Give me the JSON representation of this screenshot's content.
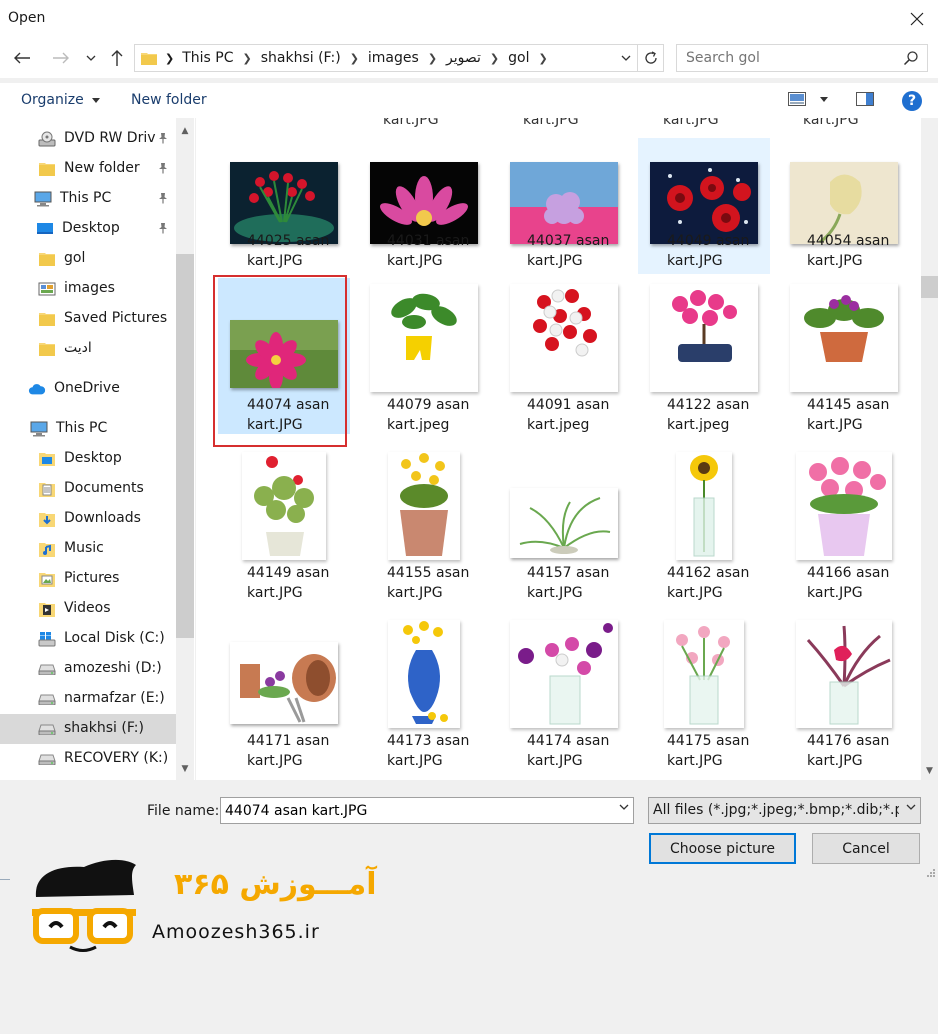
{
  "window": {
    "title": "Open"
  },
  "breadcrumb": [
    "This PC",
    "shakhsi (F:)",
    "images",
    "تصویر",
    "gol"
  ],
  "search": {
    "placeholder": "Search gol"
  },
  "toolbar": {
    "organize_label": "Organize",
    "new_folder_label": "New folder",
    "help_label": "?"
  },
  "sidebar": {
    "items": [
      {
        "label": "DVD RW Driv",
        "icon": "dvd-drive-icon",
        "pinned": true
      },
      {
        "label": "New folder",
        "icon": "folder-icon",
        "pinned": true
      },
      {
        "label": "This PC",
        "icon": "computer-icon",
        "pinned": true
      },
      {
        "label": "Desktop",
        "icon": "desktop-icon",
        "pinned": true
      },
      {
        "label": "gol",
        "icon": "folder-icon",
        "pinned": false
      },
      {
        "label": "images",
        "icon": "images-folder-icon",
        "pinned": false
      },
      {
        "label": "Saved Pictures",
        "icon": "folder-icon",
        "pinned": false
      },
      {
        "label": "ادیت",
        "icon": "folder-icon",
        "pinned": false
      },
      {
        "label": "OneDrive",
        "icon": "cloud-icon",
        "pinned": false
      },
      {
        "label": "This PC",
        "icon": "computer-icon",
        "pinned": false
      },
      {
        "label": "Desktop",
        "icon": "desktop-folder-icon",
        "pinned": false
      },
      {
        "label": "Documents",
        "icon": "documents-icon",
        "pinned": false
      },
      {
        "label": "Downloads",
        "icon": "downloads-icon",
        "pinned": false
      },
      {
        "label": "Music",
        "icon": "music-icon",
        "pinned": false
      },
      {
        "label": "Pictures",
        "icon": "pictures-icon",
        "pinned": false
      },
      {
        "label": "Videos",
        "icon": "videos-icon",
        "pinned": false
      },
      {
        "label": "Local Disk (C:)",
        "icon": "windows-drive-icon",
        "pinned": false
      },
      {
        "label": "amozeshi (D:)",
        "icon": "drive-icon",
        "pinned": false
      },
      {
        "label": "narmafzar (E:)",
        "icon": "drive-icon",
        "pinned": false
      },
      {
        "label": "shakhsi (F:)",
        "icon": "drive-icon",
        "pinned": false,
        "selected": true
      },
      {
        "label": "RECOVERY (K:)",
        "icon": "drive-icon",
        "pinned": false
      }
    ]
  },
  "files": {
    "top_partial": [
      "kart.JPG",
      "kart.JPG",
      "kart.JPG",
      "kart.JPG"
    ],
    "items": [
      {
        "name1": "44025 asan",
        "name2": "kart.JPG"
      },
      {
        "name1": "44031 asan",
        "name2": "kart.JPG"
      },
      {
        "name1": "44037 asan",
        "name2": "kart.JPG"
      },
      {
        "name1": "44049 asan",
        "name2": "kart.JPG",
        "hover": true
      },
      {
        "name1": "44054 asan",
        "name2": "kart.JPG"
      },
      {
        "name1": "44074 asan",
        "name2": "kart.JPG",
        "selected": true
      },
      {
        "name1": "44079 asan",
        "name2": "kart.jpeg"
      },
      {
        "name1": "44091 asan",
        "name2": "kart.jpeg"
      },
      {
        "name1": "44122 asan",
        "name2": "kart.jpeg"
      },
      {
        "name1": "44145 asan",
        "name2": "kart.JPG"
      },
      {
        "name1": "44149 asan",
        "name2": "kart.JPG"
      },
      {
        "name1": "44155 asan",
        "name2": "kart.JPG"
      },
      {
        "name1": "44157 asan",
        "name2": "kart.JPG"
      },
      {
        "name1": "44162 asan",
        "name2": "kart.JPG"
      },
      {
        "name1": "44166 asan",
        "name2": "kart.JPG"
      },
      {
        "name1": "44171 asan",
        "name2": "kart.JPG"
      },
      {
        "name1": "44173 asan",
        "name2": "kart.JPG"
      },
      {
        "name1": "44174 asan",
        "name2": "kart.JPG"
      },
      {
        "name1": "44175 asan",
        "name2": "kart.JPG"
      },
      {
        "name1": "44176 asan",
        "name2": "kart.JPG"
      }
    ]
  },
  "footer": {
    "file_name_label": "File name:",
    "file_name_value": "44074 asan kart.JPG",
    "file_type_value": "All files (*.jpg;*.jpeg;*.bmp;*.dib;*.png",
    "choose_label": "Choose picture",
    "cancel_label": "Cancel"
  },
  "watermark": {
    "persian": "آمـــوزش ۳۶۵",
    "latin": "Amoozesh365.ir"
  },
  "colors": {
    "accent": "#0078d7",
    "selection": "#cce8ff",
    "hover": "#e5f3ff",
    "highlight_box": "#d62f2f",
    "logo_orange": "#f5a800"
  }
}
